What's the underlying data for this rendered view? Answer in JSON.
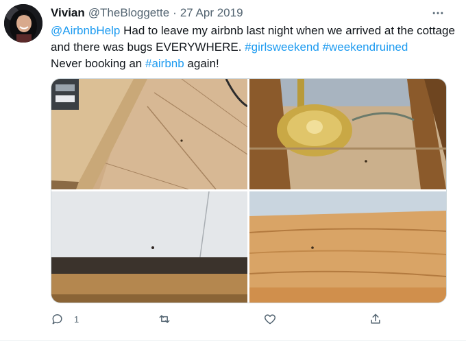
{
  "tweet": {
    "author": {
      "name": "Vivian",
      "handle": "@TheBloggette",
      "separator": "·",
      "date": "27 Apr 2019"
    },
    "text_segments": [
      {
        "text": "@AirbnbHelp",
        "link": true
      },
      {
        "text": " Had to leave my airbnb last night when we arrived at the cottage and there was bugs EVERYWHERE. ",
        "link": false
      },
      {
        "text": "#girlsweekend",
        "link": true
      },
      {
        "text": " ",
        "link": false
      },
      {
        "text": "#weekendruined",
        "link": true
      },
      {
        "text": " Never booking an ",
        "link": false
      },
      {
        "text": "#airbnb",
        "link": true
      },
      {
        "text": " again!",
        "link": false
      }
    ],
    "media_count": 4,
    "actions": {
      "reply_count": "1",
      "retweet_count": "",
      "like_count": "",
      "share_count": ""
    },
    "colors": {
      "link": "#1d9bf0",
      "secondary_text": "#536471",
      "icon": "#536471"
    }
  }
}
